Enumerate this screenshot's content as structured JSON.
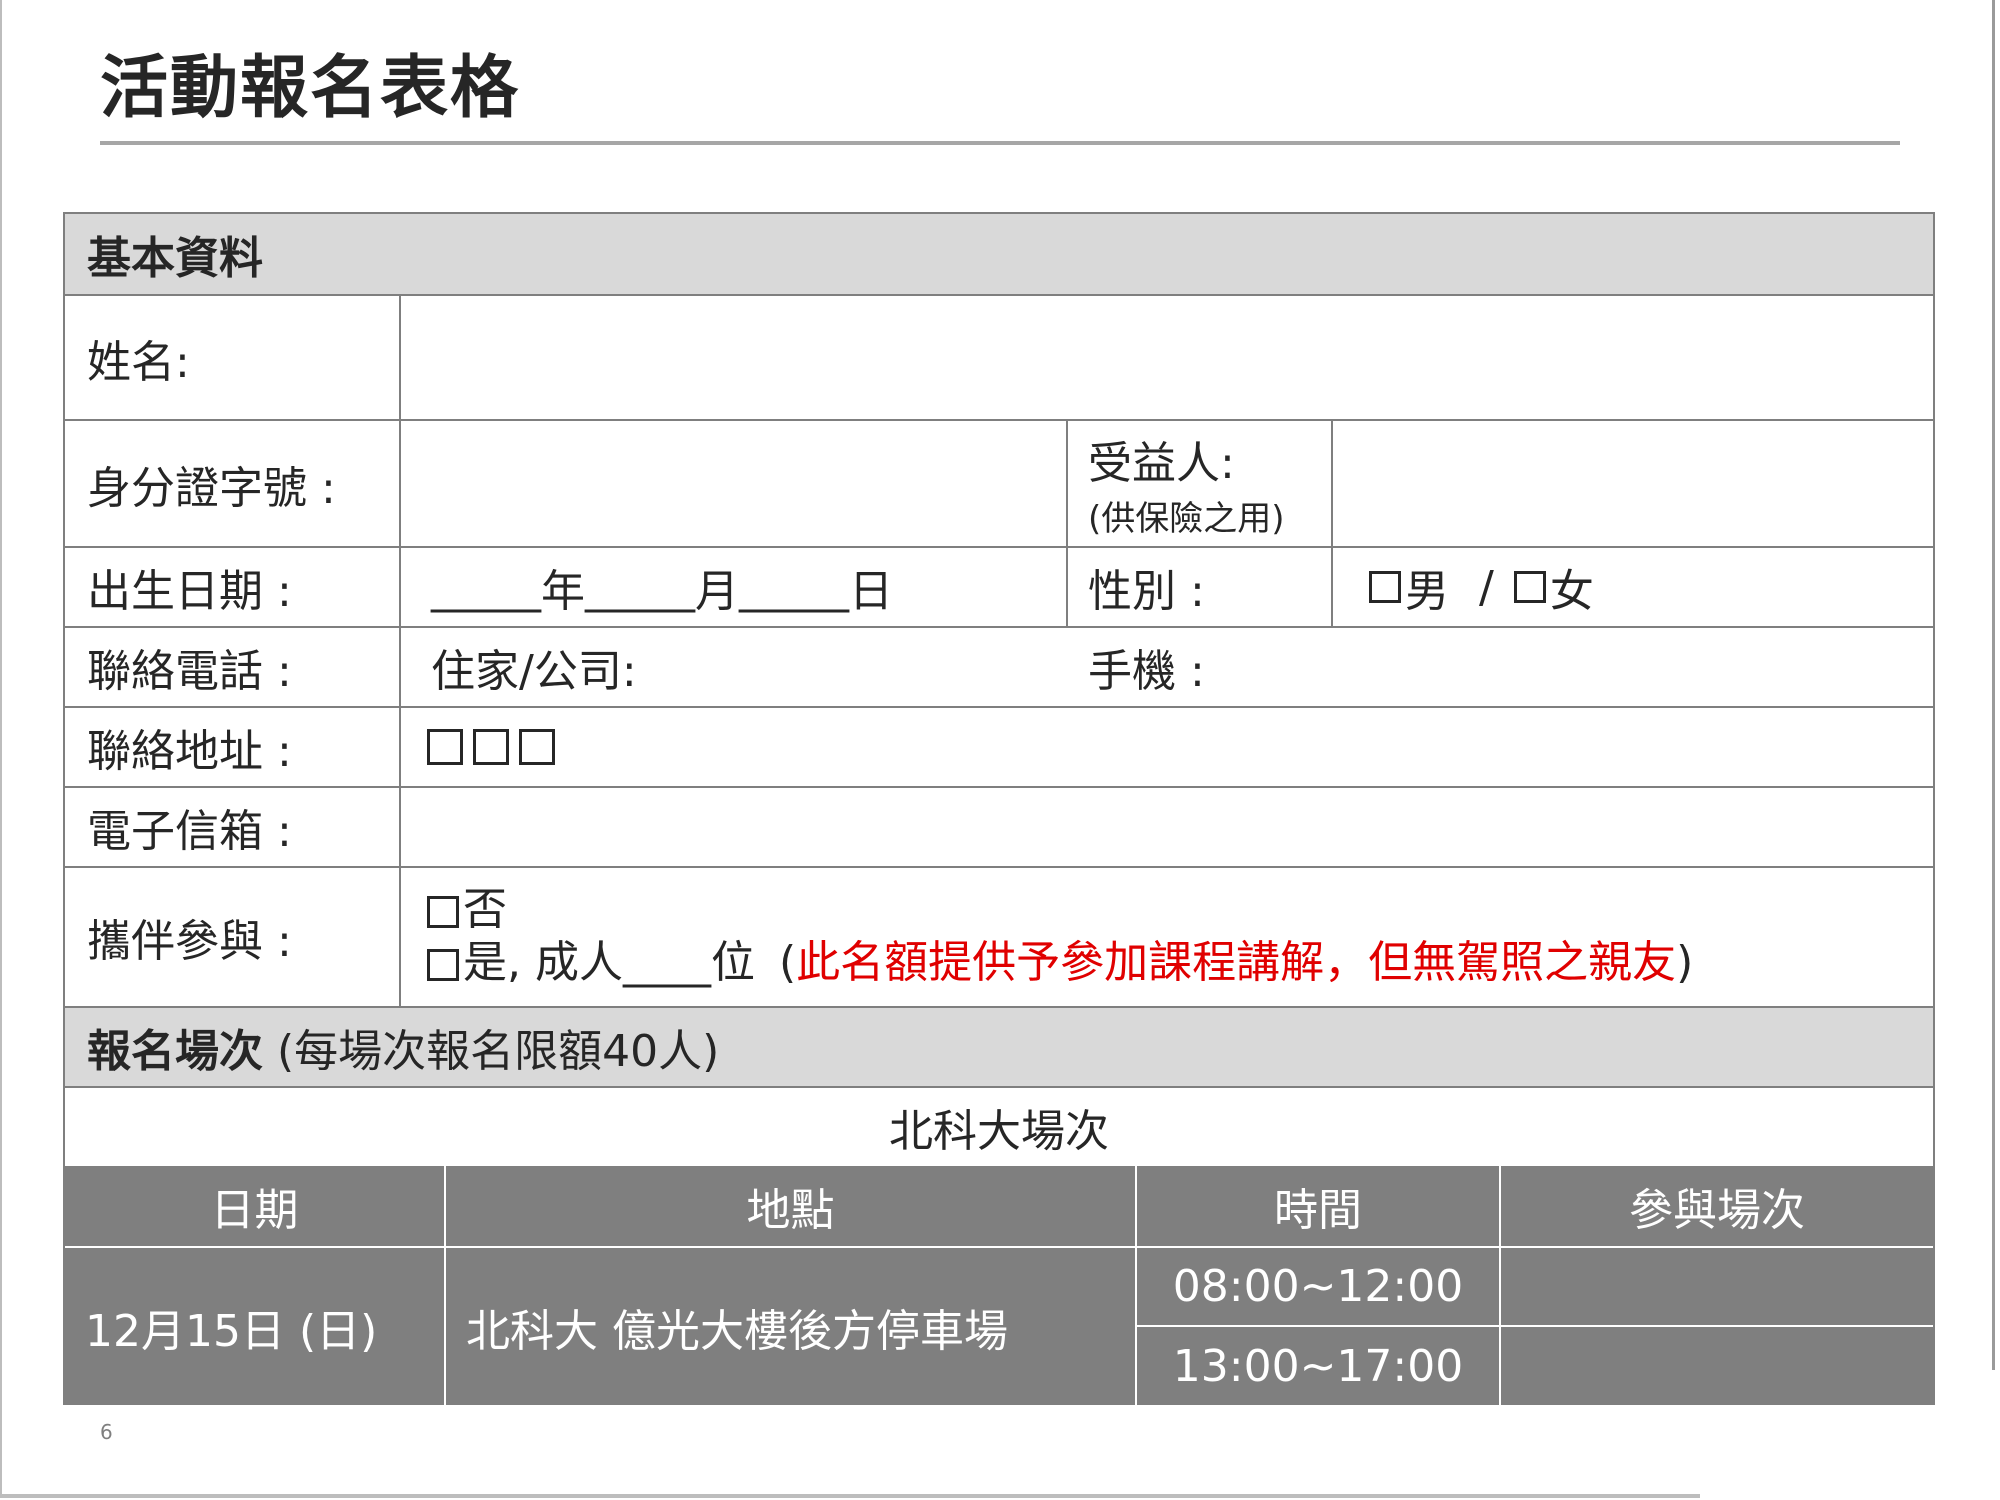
{
  "title": "活動報名表格",
  "page_number": "6",
  "section_basic": "基本資料",
  "fields": {
    "name_label": "姓名:",
    "id_label": "身分證字號 :",
    "beneficiary_label": "受益人:",
    "beneficiary_note": "(供保險之用)",
    "birth_label": "出生日期 :",
    "birth_blank_year": "_____",
    "birth_year": "年",
    "birth_blank_month": "_____",
    "birth_month": "月",
    "birth_blank_day": "_____",
    "birth_day": "日",
    "gender_label": "性別 :",
    "gender_male": "男",
    "gender_sep": "/",
    "gender_female": "女",
    "phone_label": "聯絡電話 :",
    "phone_home": "住家/公司:",
    "phone_mobile": "手機 :",
    "address_label": "聯絡地址 :",
    "email_label": "電子信箱 :",
    "companion_label": "攜伴參與 :",
    "companion_no": "否",
    "companion_yes": "是,  成人",
    "companion_blank": "____",
    "companion_unit": "位",
    "companion_note_open": "(",
    "companion_note": "此名額提供予參加課程講解，但無駕照之親友",
    "companion_note_close": ")"
  },
  "section_session": {
    "label": "報名場次",
    "note": "(每場次報名限額40人)"
  },
  "venue_title": "北科大場次",
  "table_headers": [
    "日期",
    "地點",
    "時間",
    "參與場次"
  ],
  "session": {
    "date": "12月15日 (日)",
    "location": "北科大 億光大樓後方停車場",
    "times": [
      "08:00~12:00",
      "13:00~17:00"
    ]
  }
}
